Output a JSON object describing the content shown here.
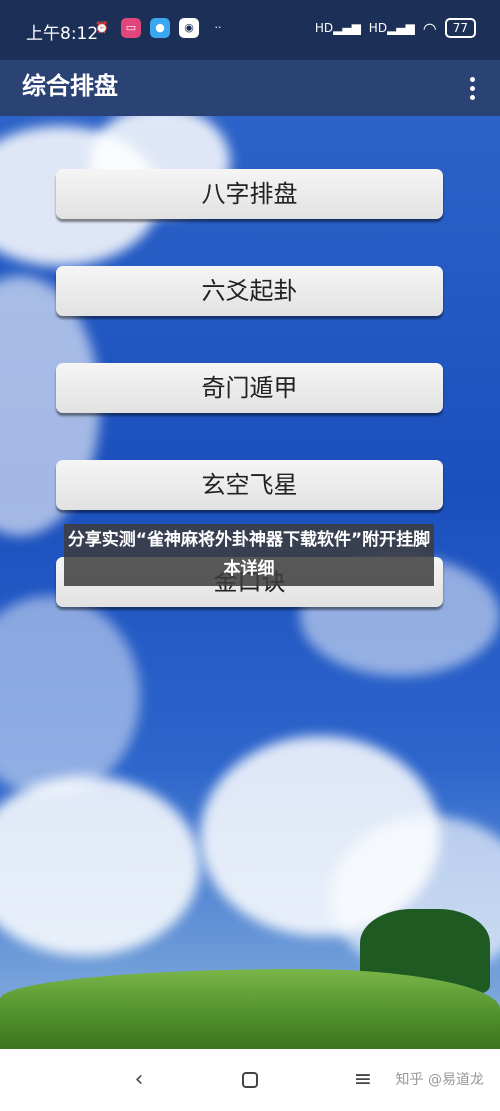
{
  "status_bar": {
    "time": "上午8:12",
    "battery": "77",
    "signal1": "HD",
    "signal2": "HD"
  },
  "app_bar": {
    "title": "综合排盘"
  },
  "menu": {
    "items": [
      {
        "label": "八字排盘"
      },
      {
        "label": "六爻起卦"
      },
      {
        "label": "奇门遁甲"
      },
      {
        "label": "玄空飞星"
      },
      {
        "label": "金口诀"
      }
    ]
  },
  "caption": {
    "text": "分享实测“雀神麻将外卦神器下载软件”附开挂脚本详细"
  },
  "nav": {
    "back": "‹",
    "menu": "≡",
    "watermark": "知乎 @易道龙"
  },
  "colors": {
    "status_bar": "#1c2f57",
    "app_bar": "#2b4374",
    "button": "#efefef"
  }
}
